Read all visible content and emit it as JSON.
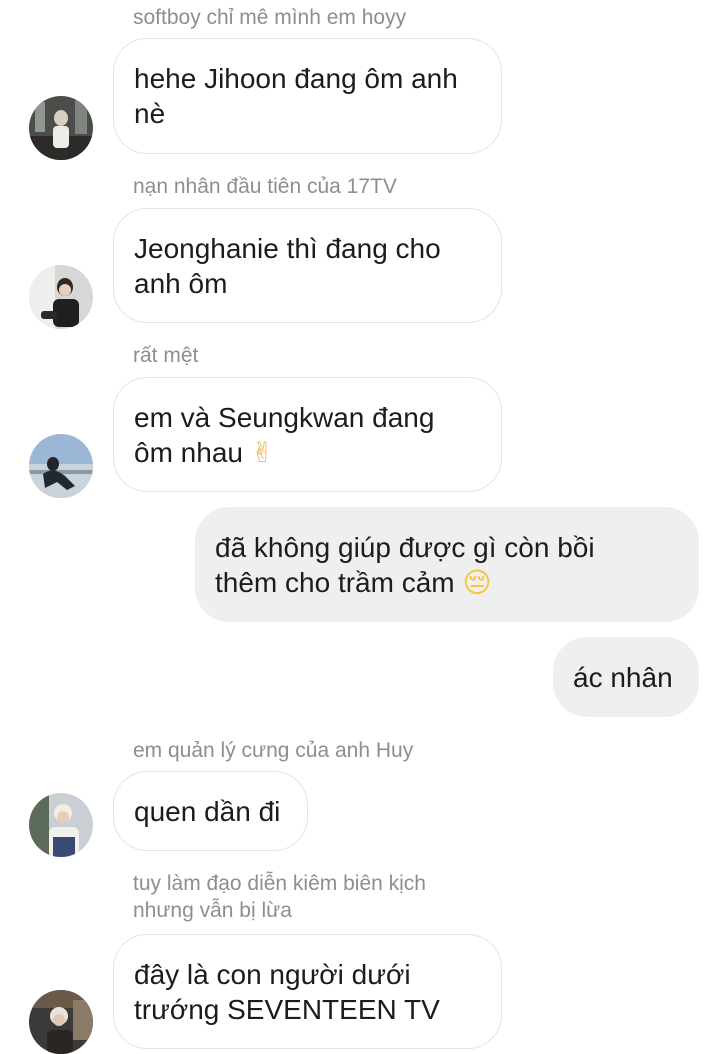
{
  "messages": [
    {
      "sender": "softboy chỉ mê mình em hoyy",
      "text": "hehe Jihoon đang ôm anh\nnè"
    },
    {
      "sender": "nạn nhân đầu tiên của 17TV",
      "text": "Jeonghanie thì đang cho\nanh ôm"
    },
    {
      "sender": "rất mệt",
      "text": "em và Seungkwan đang\nôm nhau",
      "emoji": "✌"
    },
    {
      "text": "đã không giúp được gì còn bồi\nthêm cho trầm cảm",
      "emoji": "😔"
    },
    {
      "text": "ác nhân"
    },
    {
      "sender": "em quản lý cưng của anh Huy",
      "text": "quen dần đi"
    },
    {
      "sender": "tuy làm đạo diễn kiêm biên kịch\nnhưng vẫn bị lừa",
      "text": "đây là con người dưới\ntrướng SEVENTEEN TV"
    }
  ],
  "colors": {
    "sender_text": "#8e8e8e",
    "incoming_border": "#e3e3e3",
    "outgoing_bg": "#efefef",
    "emoji_victory": "#f2b33d",
    "emoji_pensive": "#f6c43b"
  }
}
